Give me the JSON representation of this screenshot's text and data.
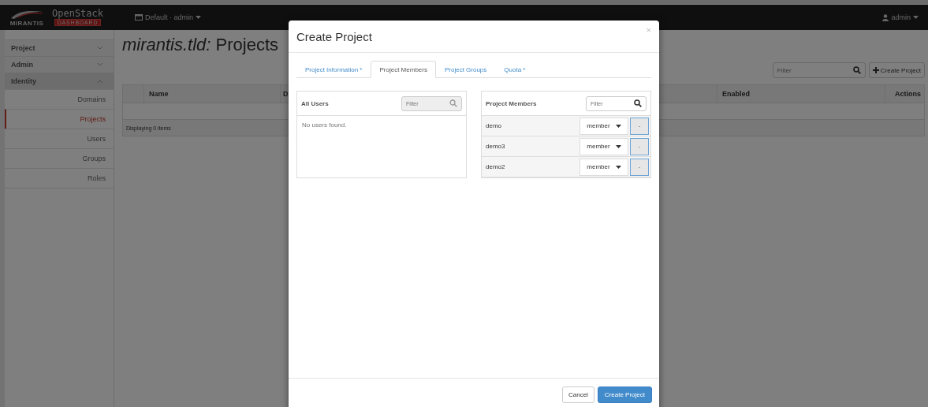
{
  "navbar": {
    "maker": "MIRANTIS",
    "product": "OpenStack",
    "badge": "DASHBOARD",
    "context_menu": "Default · admin",
    "user_menu": "admin"
  },
  "sidebar": {
    "dashboards": [
      {
        "label": "Project",
        "expanded": false
      },
      {
        "label": "Admin",
        "expanded": false
      },
      {
        "label": "Identity",
        "expanded": true,
        "children": [
          {
            "label": "Domains",
            "selected": false
          },
          {
            "label": "Projects",
            "selected": true
          },
          {
            "label": "Users",
            "selected": false
          },
          {
            "label": "Groups",
            "selected": false
          },
          {
            "label": "Roles",
            "selected": false
          }
        ]
      }
    ]
  },
  "page": {
    "title_domain": "mirantis.tld:",
    "title": "Projects",
    "filter": {
      "placeholder": "Filter"
    },
    "create_button": "Create Project",
    "table": {
      "columns": [
        "Name",
        "D",
        "Enabled",
        "Actions"
      ],
      "footer": "Displaying 0 items"
    }
  },
  "modal": {
    "title": "Create Project",
    "close": "×",
    "tabs": [
      {
        "label": "Project Information *",
        "selected": false
      },
      {
        "label": "Project Members",
        "selected": true
      },
      {
        "label": "Project Groups",
        "selected": false
      },
      {
        "label": "Quota *",
        "selected": false
      }
    ],
    "all_users": {
      "title": "All Users",
      "filter": {
        "placeholder": "Filter",
        "disabled": true
      },
      "empty": "No users found."
    },
    "members": {
      "title": "Project Members",
      "filter": {
        "placeholder": "Filter",
        "disabled": false
      },
      "rows": [
        {
          "name": "demo",
          "role": "member",
          "remove": "-"
        },
        {
          "name": "demo3",
          "role": "member",
          "remove": "-"
        },
        {
          "name": "demo2",
          "role": "member",
          "remove": "-"
        }
      ]
    },
    "buttons": {
      "cancel": "Cancel",
      "submit": "Create Project"
    }
  }
}
